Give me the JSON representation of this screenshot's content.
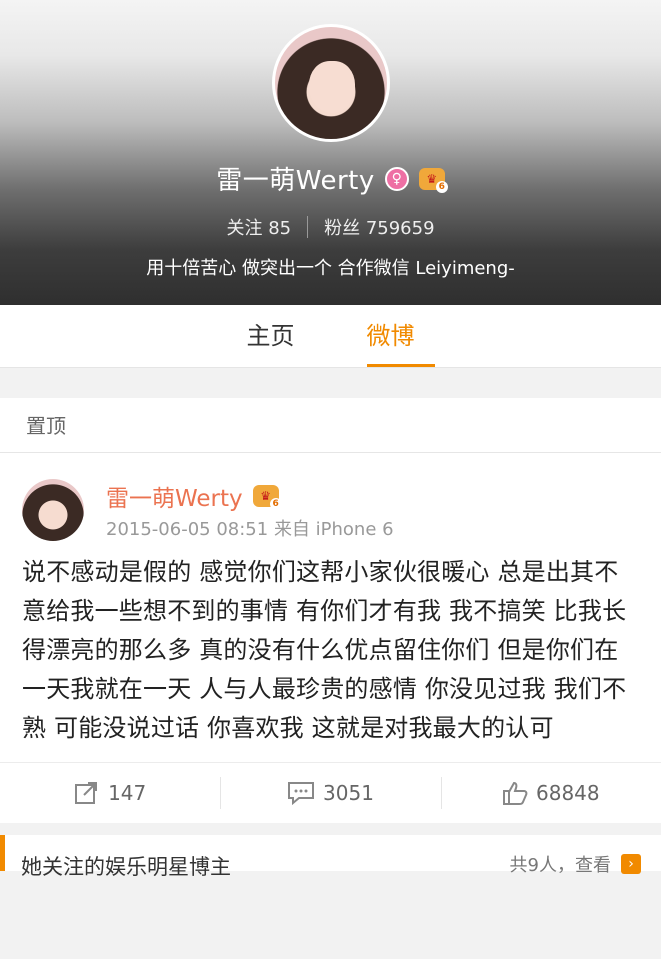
{
  "profile": {
    "name": "雷一萌Werty",
    "following_label": "关注",
    "following_count": "85",
    "followers_label": "粉丝",
    "followers_count": "759659",
    "bio": "用十倍苦心 做突出一个 合作微信 Leiyimeng-",
    "vip_level": "6"
  },
  "tabs": [
    {
      "label": "主页",
      "active": false
    },
    {
      "label": "微博",
      "active": true
    }
  ],
  "pinned_label": "置顶",
  "post": {
    "author": "雷一萌Werty",
    "timestamp": "2015-06-05 08:51",
    "source": "来自 iPhone 6",
    "text": "说不感动是假的 感觉你们这帮小家伙很暖心 总是出其不意给我一些想不到的事情 有你们才有我 我不搞笑 比我长得漂亮的那么多 真的没有什么优点留住你们 但是你们在一天我就在一天 人与人最珍贵的感情 你没见过我 我们不熟 可能没说过话 你喜欢我 这就是对我最大的认可",
    "reposts": "147",
    "comments": "3051",
    "likes": "68848"
  },
  "follow_section": {
    "title": "她关注的娱乐明星博主",
    "count_text": "共9人，查看"
  },
  "colors": {
    "accent": "#f18a00",
    "name_color": "#eb7350"
  }
}
